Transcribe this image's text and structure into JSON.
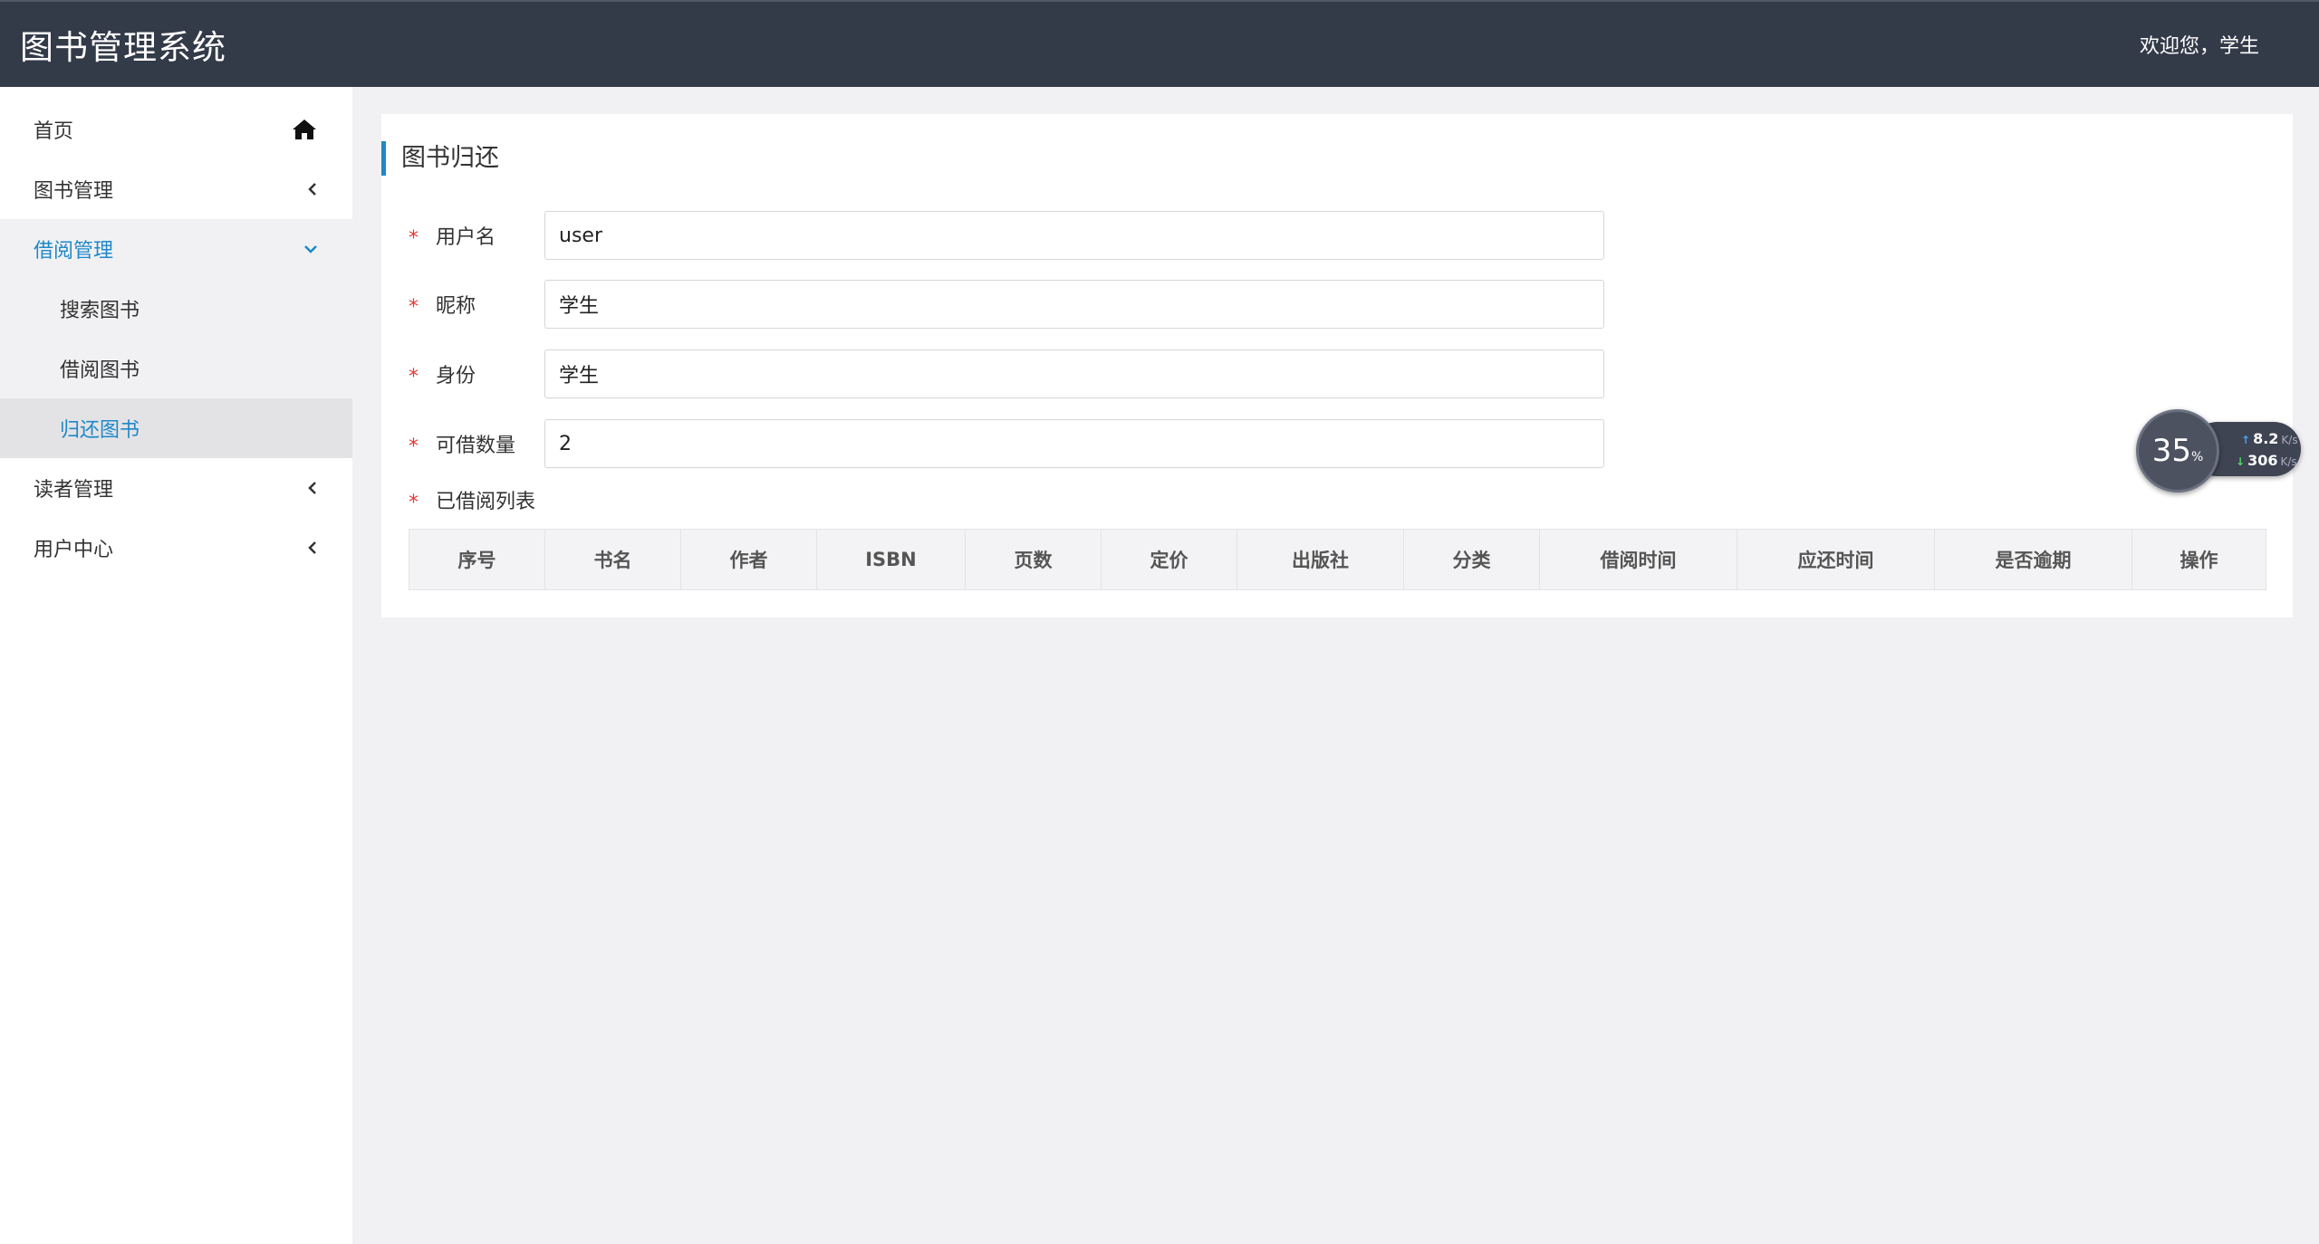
{
  "header": {
    "app_title": "图书管理系统",
    "welcome": "欢迎您，学生"
  },
  "sidebar": {
    "items": [
      {
        "label": "首页",
        "icon": "home-icon"
      },
      {
        "label": "图书管理",
        "icon": "chevron-left-icon"
      },
      {
        "label": "借阅管理",
        "icon": "chevron-down-icon",
        "open": true,
        "children": [
          {
            "label": "搜索图书"
          },
          {
            "label": "借阅图书"
          },
          {
            "label": "归还图书",
            "active": true
          }
        ]
      },
      {
        "label": "读者管理",
        "icon": "chevron-left-icon"
      },
      {
        "label": "用户中心",
        "icon": "chevron-left-icon"
      }
    ]
  },
  "panel": {
    "title": "图书归还",
    "required_mark": "*",
    "fields": [
      {
        "label": "用户名",
        "value": "user"
      },
      {
        "label": "昵称",
        "value": "学生"
      },
      {
        "label": "身份",
        "value": "学生"
      },
      {
        "label": "可借数量",
        "value": "2"
      }
    ],
    "list_label": "已借阅列表",
    "table": {
      "columns": [
        "序号",
        "书名",
        "作者",
        "ISBN",
        "页数",
        "定价",
        "出版社",
        "分类",
        "借阅时间",
        "应还时间",
        "是否逾期",
        "操作"
      ],
      "rows": []
    }
  },
  "net_widget": {
    "percent": "35",
    "percent_unit": "%",
    "upload": "8.2",
    "upload_unit": "K/s",
    "download": "306",
    "download_unit": "K/s"
  },
  "colors": {
    "accent": "#1e88c8",
    "header_bg": "#333a48",
    "required": "#e53935"
  }
}
